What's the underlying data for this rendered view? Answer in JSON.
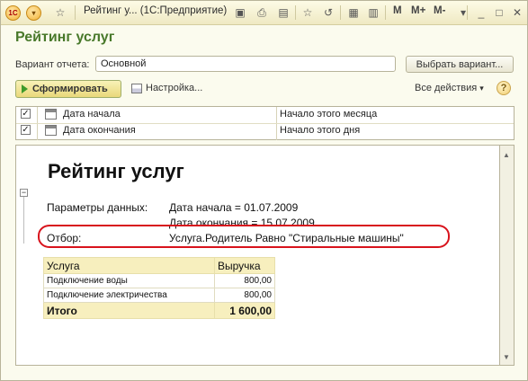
{
  "window": {
    "title": "Рейтинг у...   (1С:Предприятие)",
    "memory_buttons": [
      "M",
      "M+",
      "M-"
    ]
  },
  "page": {
    "title": "Рейтинг услуг"
  },
  "variant": {
    "label": "Вариант отчета:",
    "value": "Основной",
    "choose_button": "Выбрать вариант..."
  },
  "toolbar": {
    "generate": "Сформировать",
    "settings": "Настройка...",
    "all_actions": "Все действия",
    "help": "?"
  },
  "settings_rows": [
    {
      "checked": true,
      "name": "Дата начала",
      "value": "Начало этого месяца"
    },
    {
      "checked": true,
      "name": "Дата окончания",
      "value": "Начало этого дня"
    }
  ],
  "report": {
    "title": "Рейтинг услуг",
    "params_label": "Параметры данных:",
    "param_start": "Дата начала = 01.07.2009",
    "param_end": "Дата окончания = 15.07.2009",
    "filter_label": "Отбор:",
    "filter_value": "Услуга.Родитель Равно \"Стиральные машины\"",
    "table": {
      "headers": [
        "Услуга",
        "Выручка"
      ],
      "rows": [
        [
          "Подключение воды",
          "800,00"
        ],
        [
          "Подключение электричества",
          "800,00"
        ]
      ],
      "total": [
        "Итого",
        "1 600,00"
      ]
    }
  },
  "colors": {
    "title_green": "#49792b",
    "highlight_red": "#d8131c",
    "table_header": "#f7efbe"
  }
}
